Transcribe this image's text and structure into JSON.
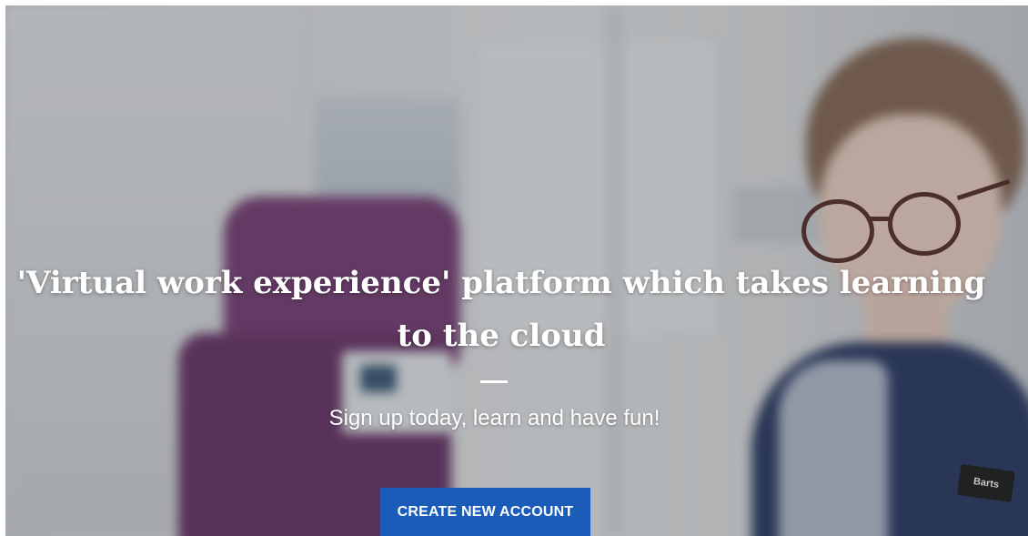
{
  "hero": {
    "headline": "'Virtual work experience' platform which takes learning to the cloud",
    "subtitle": "Sign up today, learn and have fun!",
    "cta_label": "CREATE NEW ACCOUNT",
    "badge_text": "Barts"
  },
  "colors": {
    "cta_background": "#1a5cb8",
    "text": "#ffffff",
    "chair": "#7b3f76",
    "uniform": "#2b3a63"
  }
}
